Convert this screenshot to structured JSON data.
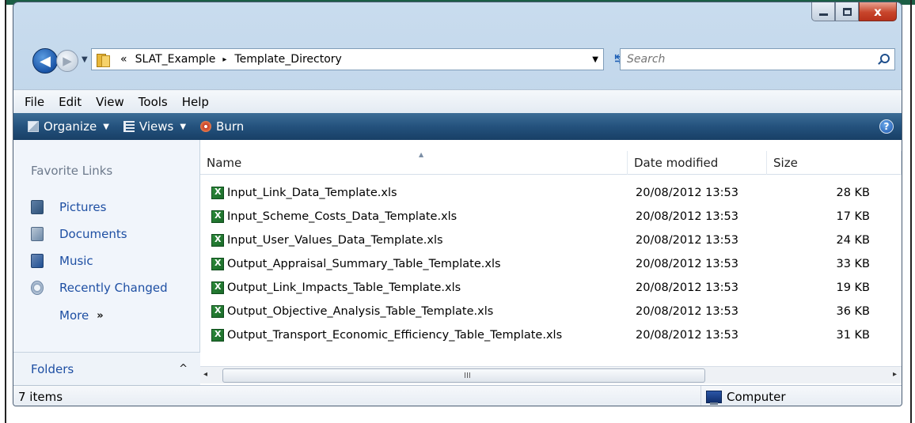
{
  "window": {
    "controls": {
      "minimize": "",
      "maximize": "",
      "close": "x"
    }
  },
  "address": {
    "overflow": "«",
    "crumbs": [
      "SLAT_Example",
      "Template_Directory"
    ],
    "separator": "▸",
    "dropdown": "▼",
    "refresh": "↹"
  },
  "search": {
    "placeholder": "Search"
  },
  "menu": {
    "items": [
      "File",
      "Edit",
      "View",
      "Tools",
      "Help"
    ]
  },
  "toolbar": {
    "organize": "Organize",
    "views": "Views",
    "burn": "Burn",
    "caret": "▼",
    "help": "?"
  },
  "nav_pane": {
    "title": "Favorite Links",
    "items": [
      "Pictures",
      "Documents",
      "Music",
      "Recently Changed"
    ],
    "more": "More",
    "more_chevron": "»",
    "folders": "Folders",
    "folders_chevron": "^"
  },
  "columns": {
    "name": "Name",
    "date": "Date modified",
    "size": "Size",
    "sort_arrow": "▲"
  },
  "files": [
    {
      "name": "Input_Link_Data_Template.xls",
      "date": "20/08/2012 13:53",
      "size": "28 KB"
    },
    {
      "name": "Input_Scheme_Costs_Data_Template.xls",
      "date": "20/08/2012 13:53",
      "size": "17 KB"
    },
    {
      "name": "Input_User_Values_Data_Template.xls",
      "date": "20/08/2012 13:53",
      "size": "24 KB"
    },
    {
      "name": "Output_Appraisal_Summary_Table_Template.xls",
      "date": "20/08/2012 13:53",
      "size": "33 KB"
    },
    {
      "name": "Output_Link_Impacts_Table_Template.xls",
      "date": "20/08/2012 13:53",
      "size": "19 KB"
    },
    {
      "name": "Output_Objective_Analysis_Table_Template.xls",
      "date": "20/08/2012 13:53",
      "size": "36 KB"
    },
    {
      "name": "Output_Transport_Economic_Efficiency_Table_Template.xls",
      "date": "20/08/2012 13:53",
      "size": "31 KB"
    }
  ],
  "scrollbar": {
    "left": "◂",
    "right": "▸",
    "grip": "III"
  },
  "status": {
    "count": "7 items",
    "zone": "Computer"
  }
}
